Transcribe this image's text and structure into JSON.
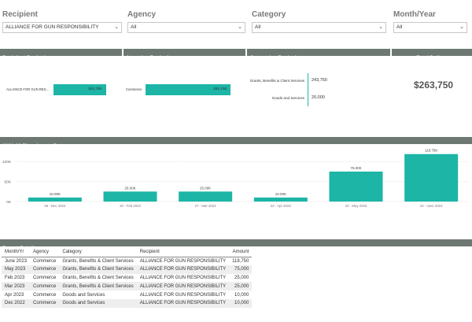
{
  "filters": [
    {
      "label": "Recipient",
      "value": "ALLIANCE FOR GUN RESPONSIBILITY"
    },
    {
      "label": "Agency",
      "value": "All"
    },
    {
      "label": "Category",
      "value": "All"
    },
    {
      "label": "Month/Year",
      "value": "All"
    }
  ],
  "headers": {
    "recipient": "Recipient Ranked",
    "agencies": "Agencies Ranked",
    "categories": "Categories Ranked",
    "total": "Total Dollars"
  },
  "recipient_ranked": [
    {
      "label": "ALLIANCE FOR GUN RES...",
      "value": 263750,
      "display": "263,750"
    }
  ],
  "agencies_ranked": [
    {
      "label": "Commerce",
      "value": 263750,
      "display": "263,750"
    }
  ],
  "categories_ranked": [
    {
      "label": "Grants, Benefits & Client Services",
      "value": 243750,
      "display": "243,750"
    },
    {
      "label": "Goods and Services",
      "value": 20000,
      "display": "20,000"
    }
  ],
  "total_dollars": "$263,750",
  "biennium": {
    "title": "2021-23  Biennium to Date"
  },
  "chart_data": {
    "type": "bar",
    "title": "2021-23  Biennium to Date",
    "categories": [
      "06 - Dec 2022",
      "20 - Feb 2023",
      "27 - Mar 2023",
      "22 - Apr 2023",
      "23 - May 2023",
      "24 - June 2023"
    ],
    "values": [
      10000,
      25000,
      25000,
      10000,
      75000,
      118750
    ],
    "data_labels": [
      "10.00K",
      "25.00K",
      "25.00K",
      "10.00K",
      "75.00K",
      "118.75K"
    ],
    "yticks": [
      0,
      50000,
      100000
    ],
    "ytick_labels": [
      "0K",
      "50K",
      "100K"
    ],
    "ylim": [
      0,
      130000
    ],
    "xlabel": "",
    "ylabel": "",
    "color": "#1cb5a6",
    "grid": true
  },
  "report": {
    "title": "Report Details",
    "columns": [
      "Month/Yr",
      "Agency",
      "Category",
      "Recipient",
      "Amount"
    ],
    "rows": [
      [
        "June 2023",
        "Commerce",
        "Grants, Benefits & Client Services",
        "ALLIANCE FOR GUN RESPONSIBILITY",
        "118,750"
      ],
      [
        "May 2023",
        "Commerce",
        "Grants, Benefits & Client Services",
        "ALLIANCE FOR GUN RESPONSIBILITY",
        "75,000"
      ],
      [
        "Feb 2023",
        "Commerce",
        "Grants, Benefits & Client Services",
        "ALLIANCE FOR GUN RESPONSIBILITY",
        "25,000"
      ],
      [
        "Mar 2023",
        "Commerce",
        "Grants, Benefits & Client Services",
        "ALLIANCE FOR GUN RESPONSIBILITY",
        "25,000"
      ],
      [
        "Apr 2023",
        "Commerce",
        "Goods and Services",
        "ALLIANCE FOR GUN RESPONSIBILITY",
        "10,000"
      ],
      [
        "Dec 2022",
        "Commerce",
        "Goods and Services",
        "ALLIANCE FOR GUN RESPONSIBILITY",
        "10,000"
      ]
    ]
  }
}
